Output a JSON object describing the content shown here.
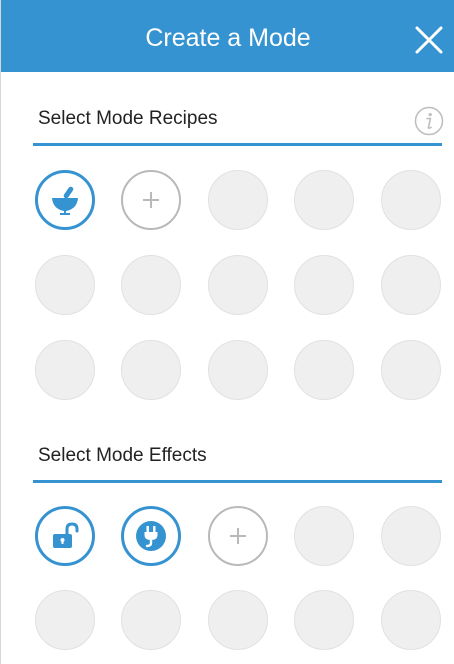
{
  "header": {
    "title": "Create a Mode",
    "close_icon": "close-x-icon",
    "background_color": "#3593d1"
  },
  "recipes": {
    "title": "Select Mode Recipes",
    "info_icon": "info-circle-icon",
    "slots": [
      {
        "state": "selected",
        "icon": "mortar-pestle-icon"
      },
      {
        "state": "add",
        "icon": "plus-icon"
      },
      {
        "state": "empty"
      },
      {
        "state": "empty"
      },
      {
        "state": "empty"
      },
      {
        "state": "empty"
      },
      {
        "state": "empty"
      },
      {
        "state": "empty"
      },
      {
        "state": "empty"
      },
      {
        "state": "empty"
      },
      {
        "state": "empty"
      },
      {
        "state": "empty"
      },
      {
        "state": "empty"
      },
      {
        "state": "empty"
      },
      {
        "state": "empty"
      }
    ]
  },
  "effects": {
    "title": "Select Mode Effects",
    "slots": [
      {
        "state": "selected",
        "icon": "unlock-icon"
      },
      {
        "state": "selected",
        "icon": "power-plug-icon"
      },
      {
        "state": "add",
        "icon": "plus-icon"
      },
      {
        "state": "empty"
      },
      {
        "state": "empty"
      },
      {
        "state": "empty"
      },
      {
        "state": "empty"
      },
      {
        "state": "empty"
      },
      {
        "state": "empty"
      },
      {
        "state": "empty"
      }
    ]
  },
  "colors": {
    "accent": "#3593d1",
    "empty_slot": "#efefef",
    "add_border": "#b9b9b9"
  }
}
